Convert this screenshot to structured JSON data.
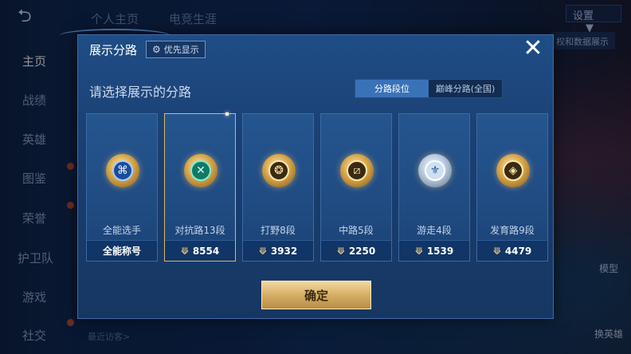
{
  "background": {
    "nav_items": [
      {
        "label": "主页",
        "active": true
      },
      {
        "label": "战绩",
        "active": false
      },
      {
        "label": "英雄",
        "active": false
      },
      {
        "label": "图鉴",
        "active": false
      },
      {
        "label": "荣誉",
        "active": false
      },
      {
        "label": "护卫队",
        "active": false
      },
      {
        "label": "游戏",
        "active": false
      },
      {
        "label": "社交",
        "active": false
      }
    ],
    "top_tabs": [
      "个人主页",
      "电竞生涯"
    ],
    "settings_label": "设置",
    "data_display_label": "权和数据展示",
    "model_label": "模型",
    "switch_hero_label": "换英雄",
    "recent_visitors": "最近访客>"
  },
  "modal": {
    "title": "展示分路",
    "priority_chip": "优先显示",
    "subtitle": "请选择展示的分路",
    "segments": [
      {
        "label": "分路段位",
        "active": true
      },
      {
        "label": "巅峰分路(全国)",
        "active": false
      }
    ],
    "cards": [
      {
        "icon": "all-round-emblem",
        "symbol": "⌘",
        "style": "blue",
        "name": "全能选手",
        "footer": "全能称号",
        "has_points": false,
        "selected": false
      },
      {
        "icon": "clash-lane-emblem",
        "symbol": "✕",
        "style": "green",
        "name": "对抗路13段",
        "footer": "8554",
        "has_points": true,
        "selected": true
      },
      {
        "icon": "jungle-emblem",
        "symbol": "❂",
        "style": "gold",
        "name": "打野8段",
        "footer": "3932",
        "has_points": true,
        "selected": false
      },
      {
        "icon": "mid-lane-emblem",
        "symbol": "⧄",
        "style": "gold",
        "name": "中路5段",
        "footer": "2250",
        "has_points": true,
        "selected": false
      },
      {
        "icon": "roam-emblem",
        "symbol": "⚜",
        "style": "silver",
        "name": "游走4段",
        "footer": "1539",
        "has_points": true,
        "selected": false
      },
      {
        "icon": "farm-lane-emblem",
        "symbol": "◈",
        "style": "gold",
        "name": "发育路9段",
        "footer": "4479",
        "has_points": true,
        "selected": false
      }
    ],
    "confirm_label": "确定"
  },
  "colors": {
    "accent_gold": "#d9b66d",
    "active_segment": "#3a72b8",
    "modal_bg": "#1f4d86"
  }
}
